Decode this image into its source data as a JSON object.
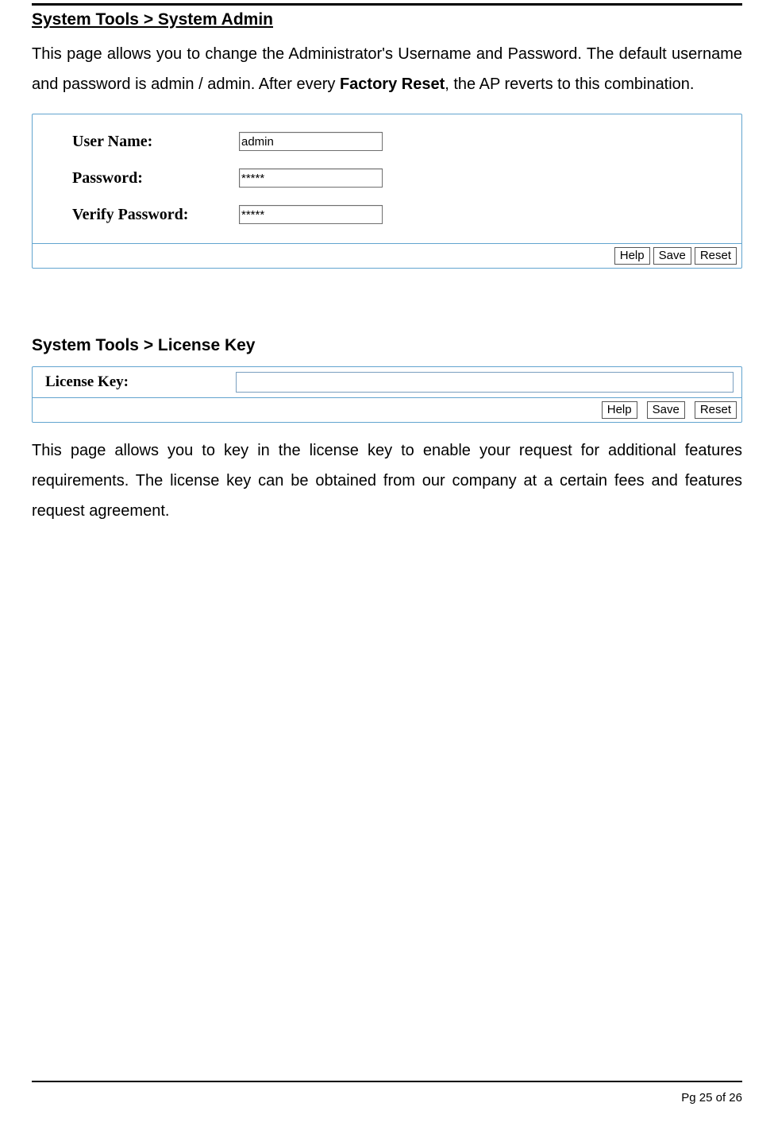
{
  "section1": {
    "heading": "System Tools > System Admin",
    "para_pre": "This page allows you to change the Administrator's Username and Password. The default username and password is admin / admin. After every ",
    "para_bold": "Factory Reset",
    "para_post": ", the AP reverts to this combination."
  },
  "admin_form": {
    "username_label": "User Name:",
    "username_value": "admin",
    "password_label": "Password:",
    "password_value": "*****",
    "verify_label": "Verify Password:",
    "verify_value": "*****",
    "buttons": {
      "help": "Help",
      "save": "Save",
      "reset": "Reset"
    }
  },
  "section2": {
    "heading": "System Tools > License Key",
    "license_label": "License Key:",
    "license_value": "",
    "buttons": {
      "help": "Help",
      "save": "Save",
      "reset": "Reset"
    },
    "para": "This page allows you to key in the license key to enable your request for additional features requirements. The license key can be obtained from our company at a certain fees and features request agreement."
  },
  "footer": {
    "page": "Pg 25 of 26"
  }
}
